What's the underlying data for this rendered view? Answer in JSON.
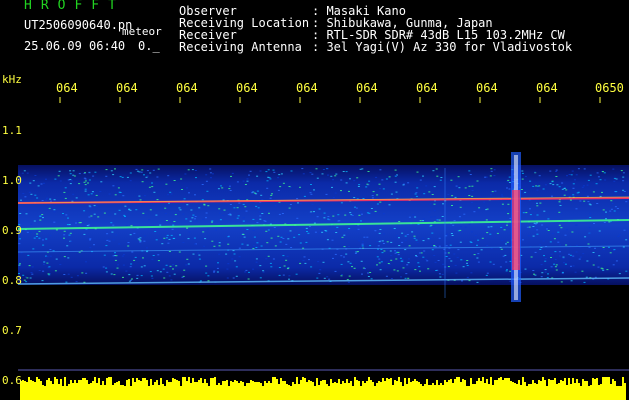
{
  "header": {
    "brand": "HROFFT",
    "filename": "UT2506090640.pn",
    "meteor_label": "meteor",
    "datetime": "25.06.09 06:40",
    "datetime_suffix": "0._",
    "info": [
      {
        "key": "Observer",
        "value": ": Masaki Kano"
      },
      {
        "key": "Receiving Location",
        "value": ": Shibukawa, Gunma, Japan"
      },
      {
        "key": "Receiver",
        "value": ": RTL-SDR SDR# 43dB L15 103.2MHz CW"
      },
      {
        "key": "Receiving Antenna",
        "value": ": 3el Yagi(V) Az 330 for Vladivostok"
      }
    ]
  },
  "axes": {
    "y_unit": "kHz",
    "y_ticks": [
      "1.1",
      "1.0",
      "0.9",
      "0.8",
      "0.7",
      "0.6"
    ],
    "x_ticks": [
      "064",
      "064",
      "064",
      "064",
      "064",
      "064",
      "064",
      "064",
      "064",
      "0650"
    ]
  },
  "colors": {
    "brand": "#21d321",
    "tick": "#ffff40",
    "noise_floor": "#0a1a80",
    "trace": "#ff3060",
    "meteor": "#ffffff",
    "audio_level": "#ffff00"
  }
}
